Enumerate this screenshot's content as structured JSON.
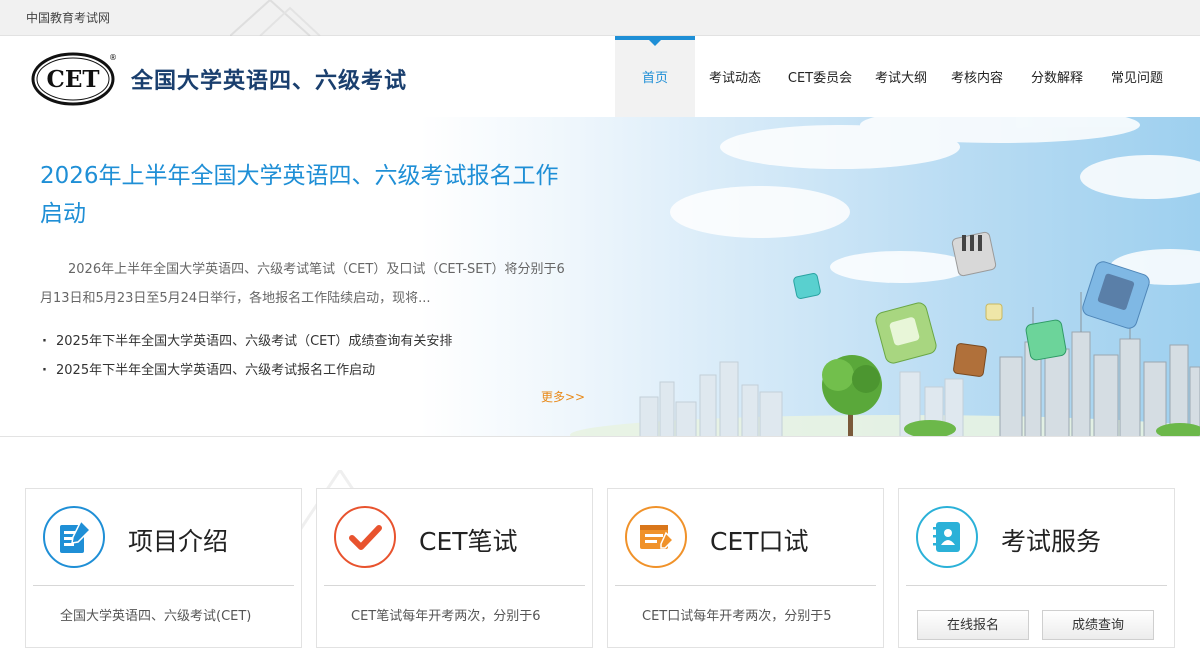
{
  "topbar": {
    "site_name": "中国教育考试网"
  },
  "header": {
    "logo_text": "CET",
    "logo_mark": "®",
    "title": "全国大学英语四、六级考试"
  },
  "nav": {
    "items": [
      {
        "label": "首页",
        "active": true
      },
      {
        "label": "考试动态",
        "active": false
      },
      {
        "label": "CET委员会",
        "active": false
      },
      {
        "label": "考试大纲",
        "active": false
      },
      {
        "label": "考核内容",
        "active": false
      },
      {
        "label": "分数解释",
        "active": false
      },
      {
        "label": "常见问题",
        "active": false
      }
    ]
  },
  "banner": {
    "headline": "2026年上半年全国大学英语四、六级考试报名工作启动",
    "summary": "2026年上半年全国大学英语四、六级考试笔试（CET）及口试（CET-SET）将分别于6月13日和5月23日至5月24日举行，各地报名工作陆续启动，现将...",
    "news": [
      "2025年下半年全国大学英语四、六级考试（CET）成绩查询有关安排",
      "2025年下半年全国大学英语四、六级考试报名工作启动"
    ],
    "more_label": "更多>>"
  },
  "cards": [
    {
      "title": "项目介绍",
      "text": "全国大学英语四、六级考试(CET)",
      "icon": "document-edit-icon",
      "color": "#1f8fd6"
    },
    {
      "title": "CET笔试",
      "text": "CET笔试每年开考两次，分别于6",
      "icon": "checkmark-icon",
      "color": "#e8532e"
    },
    {
      "title": "CET口试",
      "text": "CET口试每年开考两次，分别于5",
      "icon": "screen-pen-icon",
      "color": "#f0922a"
    },
    {
      "title": "考试服务",
      "icon": "contact-book-icon",
      "color": "#2bb1d8",
      "buttons": [
        "在线报名",
        "成绩查询"
      ]
    }
  ],
  "colors": {
    "accent": "#1f8fd6",
    "title_navy": "#1a3f6e",
    "more_orange": "#e88a1a"
  }
}
